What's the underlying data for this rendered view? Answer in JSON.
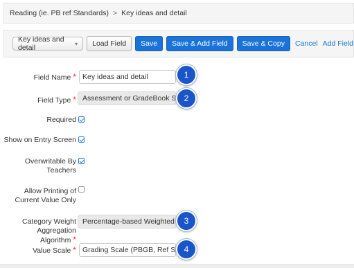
{
  "breadcrumb": {
    "parent": "Reading (ie. PB ref Standards)",
    "separator": ">",
    "current": "Key ideas and detail"
  },
  "toolbar": {
    "field_select_value": "Key ideas and detail",
    "load_field": "Load Field",
    "save": "Save",
    "save_add_field": "Save & Add Field",
    "save_copy": "Save & Copy",
    "cancel": "Cancel",
    "add_field": "Add Field"
  },
  "form": {
    "field_name": {
      "label": "Field Name",
      "required_mark": "*",
      "value": "Key ideas and detail"
    },
    "field_type": {
      "label": "Field Type",
      "required_mark": "*",
      "value": "Assessment or GradeBook Score"
    },
    "required": {
      "label": "Required",
      "checked": true
    },
    "show_on_entry": {
      "label": "Show on Entry Screen",
      "checked": true
    },
    "overwritable": {
      "label_line1": "Overwritable By",
      "label_line2": "Teachers",
      "checked": true
    },
    "allow_printing": {
      "label_line1": "Allow Printing of",
      "label_line2": "Current Value Only",
      "checked": false
    },
    "category_weight": {
      "label_line1": "Category Weight",
      "label_line2": "Aggregation Algorithm",
      "required_mark": "*",
      "value": "Percentage-based Weighted Aver"
    },
    "value_scale": {
      "label": "Value Scale",
      "required_mark": "*",
      "value": "Grading Scale (PBGB, Ref Standa"
    }
  },
  "callouts": [
    "1",
    "2",
    "3",
    "4"
  ],
  "colors": {
    "primary": "#1a73d9",
    "badge": "#1a56c9",
    "required": "#d9332b"
  }
}
